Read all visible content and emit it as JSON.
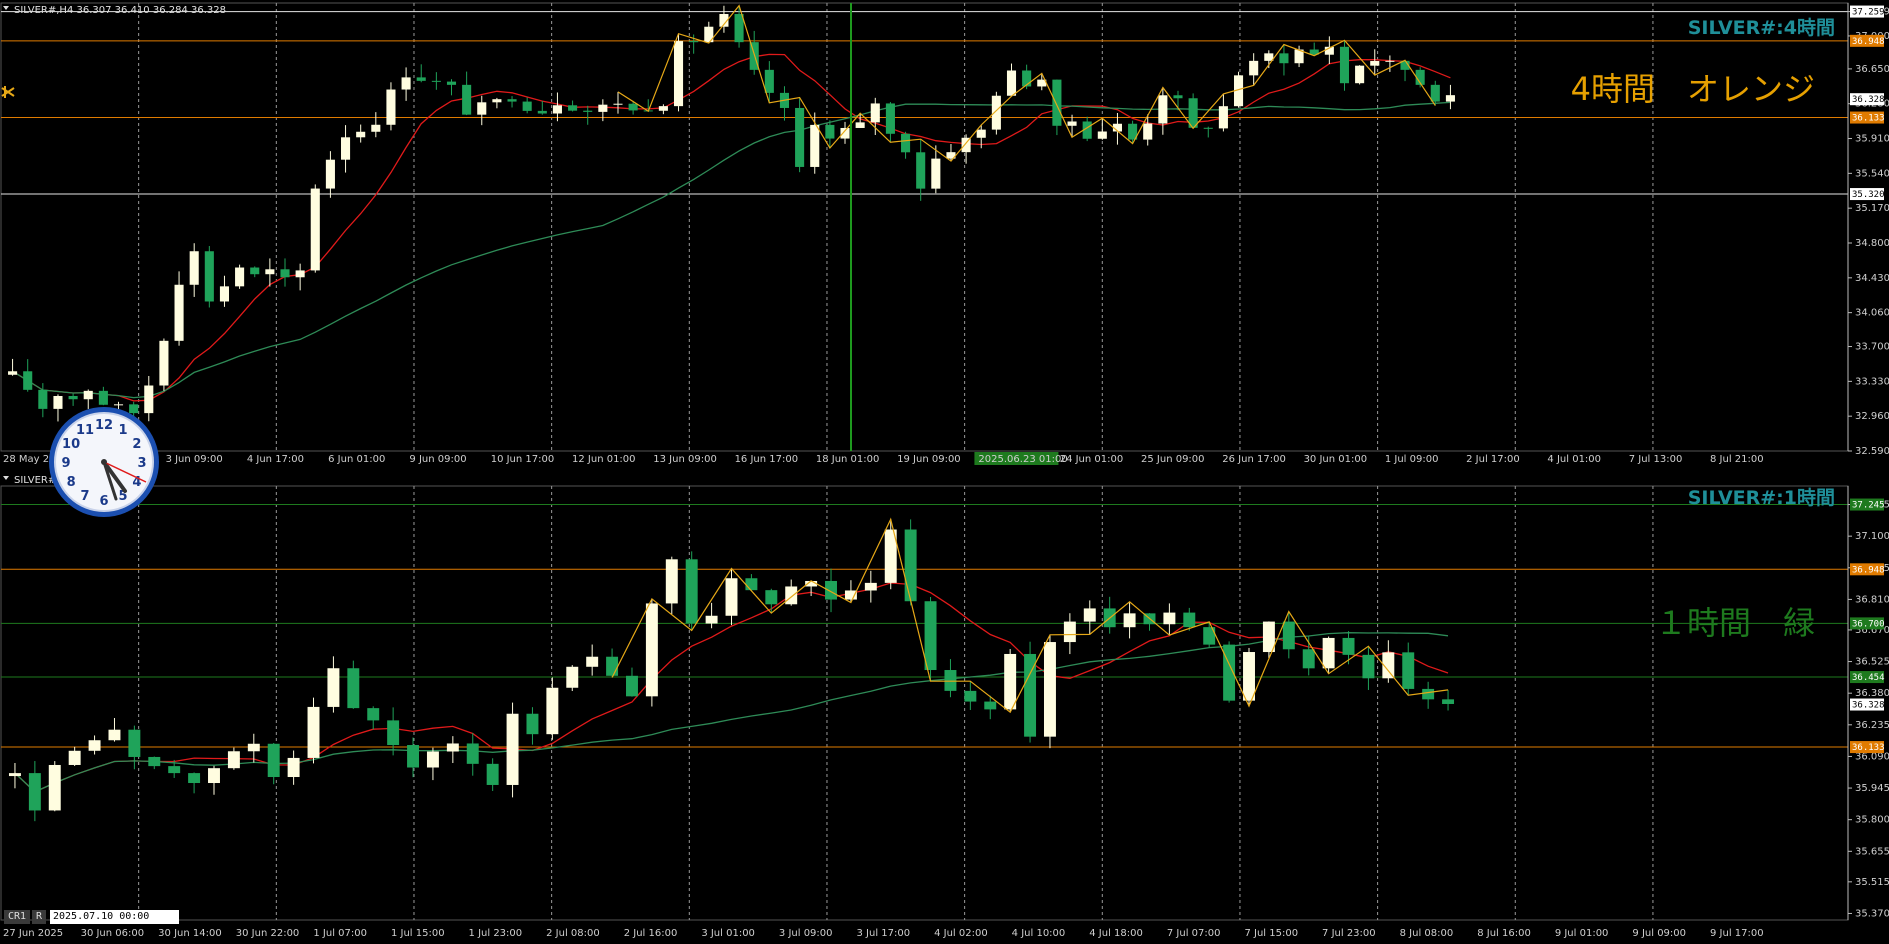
{
  "colors": {
    "background": "#000000",
    "bull_candle": "#fffde0",
    "bear_candle": "#1fa35a",
    "ma_fast": "#e01a1a",
    "ma_slow": "#2e8b57",
    "zigzag": "#e6a817",
    "orange_line": "#e07b00",
    "green_line": "#1e7a1e",
    "white_line": "#e6e6e6",
    "grid": "#9a9a9a",
    "watermark": "#1f8f99",
    "note_orange": "#e6a000",
    "note_green": "#1e7a1e",
    "cursor_line": "#1e9a1e"
  },
  "chart_data": [
    {
      "type": "candlestick",
      "header": "SILVER#,H4  36.307 36.410 36.284 36.328",
      "watermark": "SILVER#:4時間",
      "note": "4時間　オレンジ",
      "ylim": [
        32.59,
        37.35
      ],
      "y_ticks": [
        "37.259",
        "37.000",
        "36.650",
        "36.280",
        "35.910",
        "35.540",
        "35.170",
        "34.800",
        "34.430",
        "34.060",
        "33.700",
        "33.330",
        "32.960",
        "32.590"
      ],
      "price_tags": [
        {
          "value": 37.259,
          "label": "37.259",
          "style": "white"
        },
        {
          "value": 36.948,
          "label": "36.948",
          "style": "orange"
        },
        {
          "value": 36.328,
          "label": "36.328",
          "style": "white"
        },
        {
          "value": 36.133,
          "label": "36.133",
          "style": "orange"
        },
        {
          "value": 35.32,
          "label": "35.320",
          "style": "white"
        }
      ],
      "hlines": [
        {
          "value": 37.259,
          "style": "white"
        },
        {
          "value": 36.948,
          "style": "orange"
        },
        {
          "value": 36.133,
          "style": "orange"
        },
        {
          "value": 35.32,
          "style": "white"
        }
      ],
      "x_labels": [
        "28 May 2025",
        "",
        "3 Jun 09:00",
        "4 Jun 17:00",
        "6 Jun 01:00",
        "9 Jun 09:00",
        "10 Jun 17:00",
        "12 Jun 01:00",
        "13 Jun 09:00",
        "16 Jun 17:00",
        "18 Jun 01:00",
        "19 Jun 09:00",
        "2025.06.23 01:00",
        "24 Jun 01:00",
        "25 Jun 09:00",
        "26 Jun 17:00",
        "30 Jun 01:00",
        "1 Jul 09:00",
        "2 Jul 17:00",
        "4 Jul 01:00",
        "7 Jul 13:00",
        "8 Jul 21:00"
      ],
      "cursor_label": "2025.06.23 01:00",
      "close_path": [
        33.4,
        33.25,
        33.05,
        33.2,
        33.15,
        33.25,
        33.1,
        33.05,
        33.0,
        33.3,
        33.8,
        34.4,
        34.7,
        34.2,
        34.35,
        34.55,
        34.45,
        34.5,
        34.4,
        34.5,
        35.4,
        35.7,
        35.95,
        36.0,
        36.1,
        36.4,
        36.6,
        36.55,
        36.5,
        36.45,
        36.2,
        36.25,
        36.3,
        36.35,
        36.25,
        36.2,
        36.3,
        36.25,
        36.2,
        36.25,
        36.3,
        36.2,
        36.25,
        36.3,
        36.9,
        36.95,
        37.1,
        37.2,
        36.9,
        36.6,
        36.4,
        36.2,
        35.6,
        36.1,
        35.9,
        36.0,
        36.05,
        36.3,
        35.95,
        35.8,
        35.4,
        35.7,
        35.8,
        35.9,
        36.0,
        36.4,
        36.6,
        36.5,
        36.55,
        36.0,
        36.1,
        35.95,
        36.0,
        36.05,
        35.9,
        36.1,
        36.4,
        36.3,
        36.0,
        36.05,
        36.25,
        36.6,
        36.7,
        36.8,
        36.75,
        36.85,
        36.8,
        36.9,
        36.5,
        36.7,
        36.75,
        36.7,
        36.65,
        36.5,
        36.35,
        36.33
      ]
    },
    {
      "type": "candlestick",
      "header": "SILVER#,H1  36.328",
      "watermark": "SILVER#:1時間",
      "note": "１時間　緑",
      "ylim": [
        35.34,
        37.33
      ],
      "y_ticks": [
        "37.245",
        "37.100",
        "36.955",
        "36.810",
        "36.670",
        "36.525",
        "36.380",
        "36.235",
        "36.090",
        "35.945",
        "35.800",
        "35.655",
        "35.515",
        "35.370"
      ],
      "price_tags": [
        {
          "value": 37.245,
          "label": "37.245",
          "style": "green"
        },
        {
          "value": 36.948,
          "label": "36.948",
          "style": "orange"
        },
        {
          "value": 36.7,
          "label": "36.700",
          "style": "green"
        },
        {
          "value": 36.454,
          "label": "36.454",
          "style": "green"
        },
        {
          "value": 36.328,
          "label": "36.328",
          "style": "white"
        },
        {
          "value": 36.133,
          "label": "36.133",
          "style": "orange"
        }
      ],
      "hlines": [
        {
          "value": 37.245,
          "style": "green"
        },
        {
          "value": 36.948,
          "style": "orange"
        },
        {
          "value": 36.7,
          "style": "green"
        },
        {
          "value": 36.454,
          "style": "green"
        },
        {
          "value": 36.133,
          "style": "orange"
        }
      ],
      "x_labels": [
        "27 Jun 2025",
        "30 Jun 06:00",
        "30 Jun 14:00",
        "30 Jun 22:00",
        "1 Jul 07:00",
        "1 Jul 15:00",
        "1 Jul 23:00",
        "2 Jul 08:00",
        "2 Jul 16:00",
        "3 Jul 01:00",
        "3 Jul 09:00",
        "3 Jul 17:00",
        "4 Jul 02:00",
        "4 Jul 10:00",
        "4 Jul 18:00",
        "7 Jul 07:00",
        "7 Jul 15:00",
        "7 Jul 23:00",
        "8 Jul 08:00",
        "8 Jul 16:00",
        "9 Jul 01:00",
        "9 Jul 09:00",
        "9 Jul 17:00"
      ],
      "close_path": [
        36.0,
        35.85,
        36.05,
        36.1,
        36.15,
        36.2,
        36.1,
        36.05,
        36.0,
        35.95,
        36.05,
        36.1,
        36.15,
        36.0,
        36.1,
        36.3,
        36.5,
        36.3,
        36.25,
        36.15,
        36.05,
        36.1,
        36.15,
        36.05,
        35.95,
        36.3,
        36.2,
        36.4,
        36.5,
        36.55,
        36.45,
        36.35,
        36.8,
        37.0,
        36.7,
        36.75,
        36.9,
        36.85,
        36.8,
        36.85,
        36.9,
        36.8,
        36.85,
        36.9,
        37.15,
        36.8,
        36.5,
        36.4,
        36.35,
        36.3,
        36.55,
        36.2,
        36.6,
        36.7,
        36.75,
        36.7,
        36.75,
        36.7,
        36.75,
        36.7,
        36.6,
        36.35,
        36.55,
        36.7,
        36.6,
        36.5,
        36.65,
        36.55,
        36.45,
        36.55,
        36.4,
        36.35,
        36.33
      ]
    }
  ],
  "clock": {
    "numbers": [
      "12",
      "1",
      "2",
      "3",
      "4",
      "5",
      "6",
      "7",
      "8",
      "9",
      "10",
      "11"
    ]
  },
  "status_bar": {
    "tab1": "CR1",
    "tab2": "R",
    "time": "2025.07.10 00:00"
  }
}
